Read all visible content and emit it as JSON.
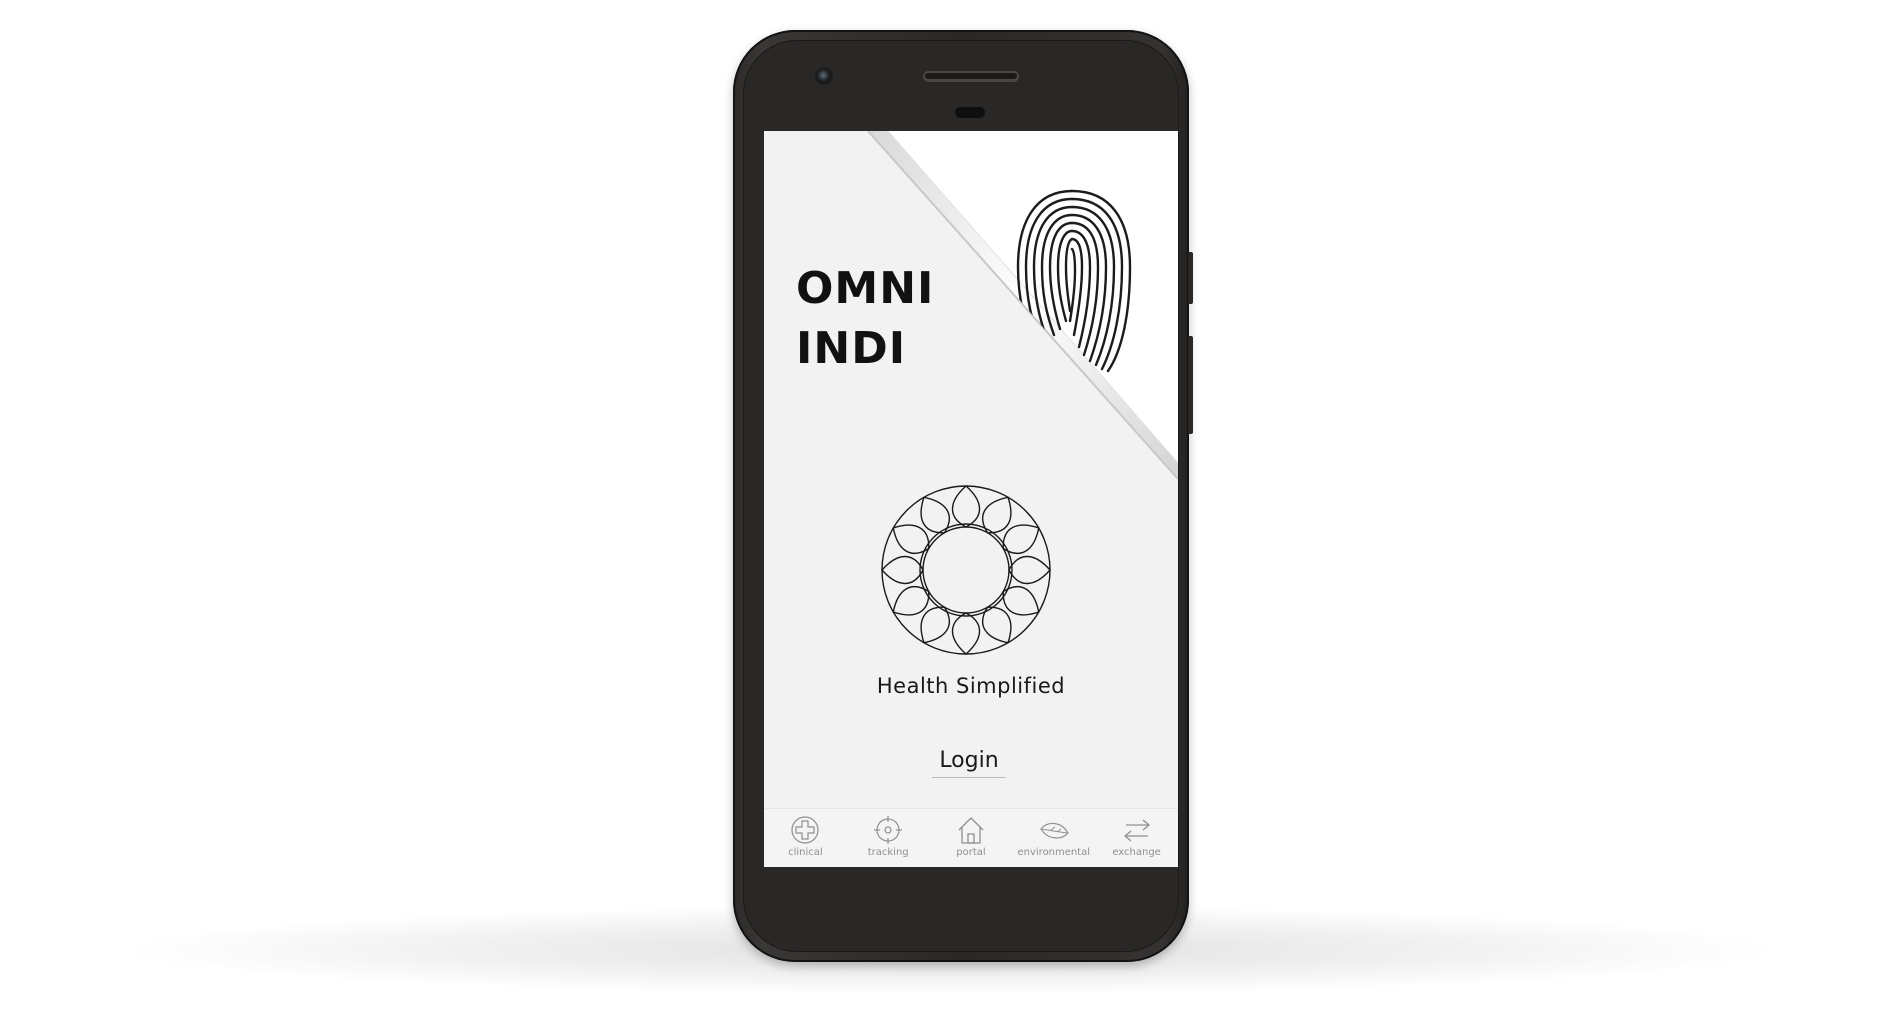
{
  "app": {
    "brand_line1": "OMNI",
    "brand_line2": "INDI",
    "tagline": "Health Simplified",
    "login_label": "Login"
  },
  "nav": {
    "items": [
      {
        "label": "clinical",
        "icon": "cross-circle-icon"
      },
      {
        "label": "tracking",
        "icon": "crosshair-icon"
      },
      {
        "label": "portal",
        "icon": "home-icon"
      },
      {
        "label": "environmental",
        "icon": "leaf-icon"
      },
      {
        "label": "exchange",
        "icon": "swap-arrows-icon"
      }
    ]
  },
  "colors": {
    "screen_background": "#f2f2f2",
    "text": "#111111",
    "nav_icon": "#8f8f8f",
    "device_body": "#2a2826"
  }
}
